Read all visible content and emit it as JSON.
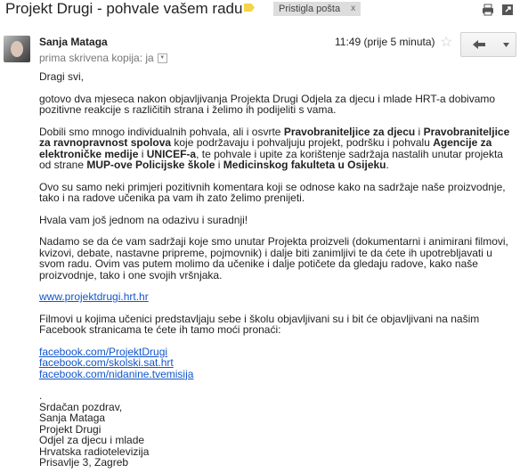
{
  "header": {
    "subject": "Projekt Drugi - pohvale vašem radu",
    "label": "Pristigla pošta",
    "label_remove": "x"
  },
  "message": {
    "sender": "Sanja Mataga",
    "recipient_prefix": "prima skrivena kopija: ja",
    "time": "11:49 (prije 5 minuta)",
    "greeting": "Dragi svi,",
    "para1": "gotovo dva mjeseca nakon objavljivanja Projekta Drugi Odjela za djecu i mlade HRT-a dobivamo pozitivne reakcije s različitih strana i želimo ih podijeliti s vama.",
    "para2": {
      "t1": "Dobili smo mnogo individualnih pohvala, ali i osvrte ",
      "b1": "Pravobraniteljice za djecu",
      "t2": " i ",
      "b2": "Pravobraniteljice za ravnopravnost spolova",
      "t3": " koje podržavaju i pohvaljuju projekt, podršku i pohvalu ",
      "b3": "Agencije za elektroničke medije",
      "t4": " i ",
      "b4": "UNICEF-a",
      "t5": ", te pohvale i upite za korištenje sadržaja nastalih unutar projekta od strane ",
      "b5": "MUP-ove Policijske škole",
      "t6": " i ",
      "b6": "Medicinskog fakulteta u Osijeku",
      "t7": "."
    },
    "para3": "Ovo su samo neki primjeri pozitivnih komentara koji se odnose kako na sadržaje naše proizvodnje, tako i na radove učenika pa vam ih zato želimo prenijeti.",
    "para4": "Hvala vam još jednom na odazivu i suradnji!",
    "para5": "Nadamo se da će vam sadržaji koje smo unutar Projekta proizveli (dokumentarni i animirani filmovi, kvizovi, debate, nastavne pripreme, pojmovnik) i dalje biti zanimljivi te da ćete ih upotrebljavati u svom radu. Ovim vas putem molimo da učenike i dalje potičete da gledaju radove, kako naše proizvodnje, tako i one svojih vršnjaka.",
    "link_main": "www.projektdrugi.hrt.hr",
    "para6": "Filmovi u kojima učenici predstavljaju sebe i školu objavljivani su i bit će objavljivani na našim Facebook stranicama te ćete ih tamo moći pronaći:",
    "fb_links": [
      "facebook.com/ProjektDrugi",
      "facebook.com/skolski.sat.hrt",
      "facebook.com/nidanine.tvemisija"
    ],
    "dot": ".",
    "signature": [
      "Srdačan pozdrav,",
      "Sanja Mataga",
      "Projekt Drugi",
      "Odjel za djecu i mlade",
      "Hrvatska radiotelevizija",
      "Prisavlje 3, Zagreb"
    ]
  },
  "icons": {
    "print": "print-icon",
    "popout": "popout-icon",
    "star": "star-icon",
    "reply": "reply-icon",
    "more": "dropdown-icon"
  }
}
